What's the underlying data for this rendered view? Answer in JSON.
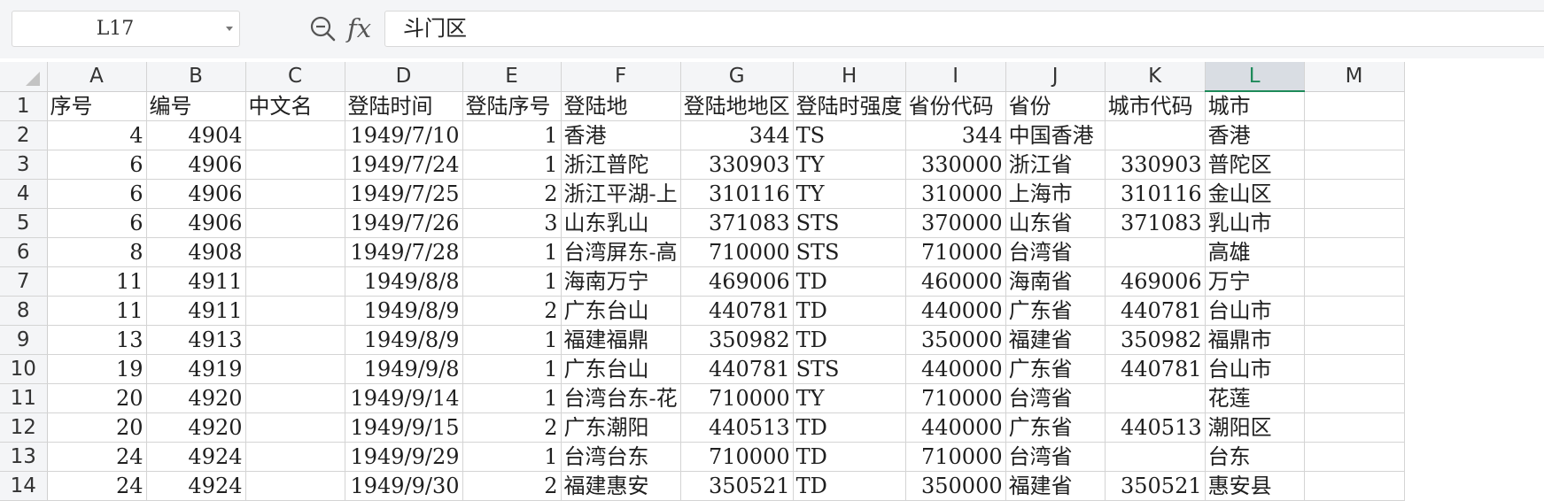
{
  "formula_bar": {
    "name_box": "L17",
    "zoom_icon": "zoom-in-icon",
    "fx_label": "fx",
    "content": "斗门区"
  },
  "columns": [
    "A",
    "B",
    "C",
    "D",
    "E",
    "F",
    "G",
    "H",
    "I",
    "J",
    "K",
    "L",
    "M"
  ],
  "selected_column": "L",
  "rows": [
    {
      "n": "1",
      "cells": [
        "序号",
        "编号",
        "中文名",
        "登陆时间",
        "登陆序号",
        "登陆地",
        "登陆地地区",
        "登陆时强度",
        "省份代码",
        "省份",
        "城市代码",
        "城市",
        ""
      ]
    },
    {
      "n": "2",
      "cells": [
        "4",
        "4904",
        "",
        "1949/7/10",
        "1",
        "香港",
        "344",
        "TS",
        "344",
        "中国香港",
        "",
        "香港",
        ""
      ]
    },
    {
      "n": "3",
      "cells": [
        "6",
        "4906",
        "",
        "1949/7/24",
        "1",
        "浙江普陀",
        "330903",
        "TY",
        "330000",
        "浙江省",
        "330903",
        "普陀区",
        ""
      ]
    },
    {
      "n": "4",
      "cells": [
        "6",
        "4906",
        "",
        "1949/7/25",
        "2",
        "浙江平湖-上",
        "310116",
        "TY",
        "310000",
        "上海市",
        "310116",
        "金山区",
        ""
      ]
    },
    {
      "n": "5",
      "cells": [
        "6",
        "4906",
        "",
        "1949/7/26",
        "3",
        "山东乳山",
        "371083",
        "STS",
        "370000",
        "山东省",
        "371083",
        "乳山市",
        ""
      ]
    },
    {
      "n": "6",
      "cells": [
        "8",
        "4908",
        "",
        "1949/7/28",
        "1",
        "台湾屏东-高",
        "710000",
        "STS",
        "710000",
        "台湾省",
        "",
        "高雄",
        ""
      ]
    },
    {
      "n": "7",
      "cells": [
        "11",
        "4911",
        "",
        "1949/8/8",
        "1",
        "海南万宁",
        "469006",
        "TD",
        "460000",
        "海南省",
        "469006",
        "万宁",
        ""
      ]
    },
    {
      "n": "8",
      "cells": [
        "11",
        "4911",
        "",
        "1949/8/9",
        "2",
        "广东台山",
        "440781",
        "TD",
        "440000",
        "广东省",
        "440781",
        "台山市",
        ""
      ]
    },
    {
      "n": "9",
      "cells": [
        "13",
        "4913",
        "",
        "1949/8/9",
        "1",
        "福建福鼎",
        "350982",
        "TD",
        "350000",
        "福建省",
        "350982",
        "福鼎市",
        ""
      ]
    },
    {
      "n": "10",
      "cells": [
        "19",
        "4919",
        "",
        "1949/9/8",
        "1",
        "广东台山",
        "440781",
        "STS",
        "440000",
        "广东省",
        "440781",
        "台山市",
        ""
      ]
    },
    {
      "n": "11",
      "cells": [
        "20",
        "4920",
        "",
        "1949/9/14",
        "1",
        "台湾台东-花",
        "710000",
        "TY",
        "710000",
        "台湾省",
        "",
        "花莲",
        ""
      ]
    },
    {
      "n": "12",
      "cells": [
        "20",
        "4920",
        "",
        "1949/9/15",
        "2",
        "广东潮阳",
        "440513",
        "TD",
        "440000",
        "广东省",
        "440513",
        "潮阳区",
        ""
      ]
    },
    {
      "n": "13",
      "cells": [
        "24",
        "4924",
        "",
        "1949/9/29",
        "1",
        "台湾台东",
        "710000",
        "TD",
        "710000",
        "台湾省",
        "",
        "台东",
        ""
      ]
    },
    {
      "n": "14",
      "cells": [
        "24",
        "4924",
        "",
        "1949/9/30",
        "2",
        "福建惠安",
        "350521",
        "TD",
        "350000",
        "福建省",
        "350521",
        "惠安县",
        ""
      ]
    }
  ]
}
